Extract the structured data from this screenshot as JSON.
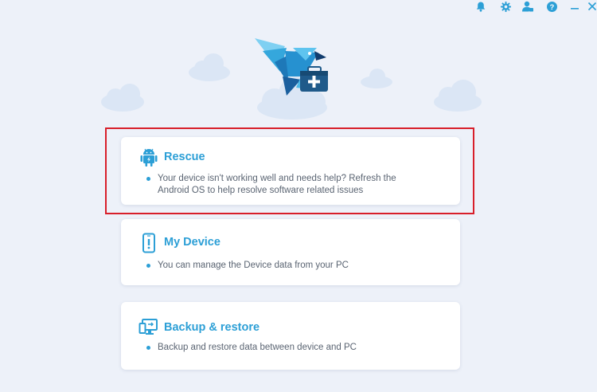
{
  "topbar": {
    "icons": [
      "bell-icon",
      "gear-icon",
      "user-icon",
      "help-icon",
      "minimize-icon",
      "close-icon"
    ]
  },
  "cards": [
    {
      "title": "Rescue",
      "icon": "android-icon",
      "description": "Your device isn't working well and needs help? Refresh the Android OS to help resolve software related issues"
    },
    {
      "title": "My Device",
      "icon": "phone-alert-icon",
      "description": "You can manage the Device data from your PC"
    },
    {
      "title": "Backup & restore",
      "icon": "backup-icon",
      "description": "Backup and restore data between device and PC"
    }
  ],
  "colors": {
    "accent": "#2c9fd6",
    "background": "#edf1f9",
    "highlight": "#d81f2a"
  }
}
